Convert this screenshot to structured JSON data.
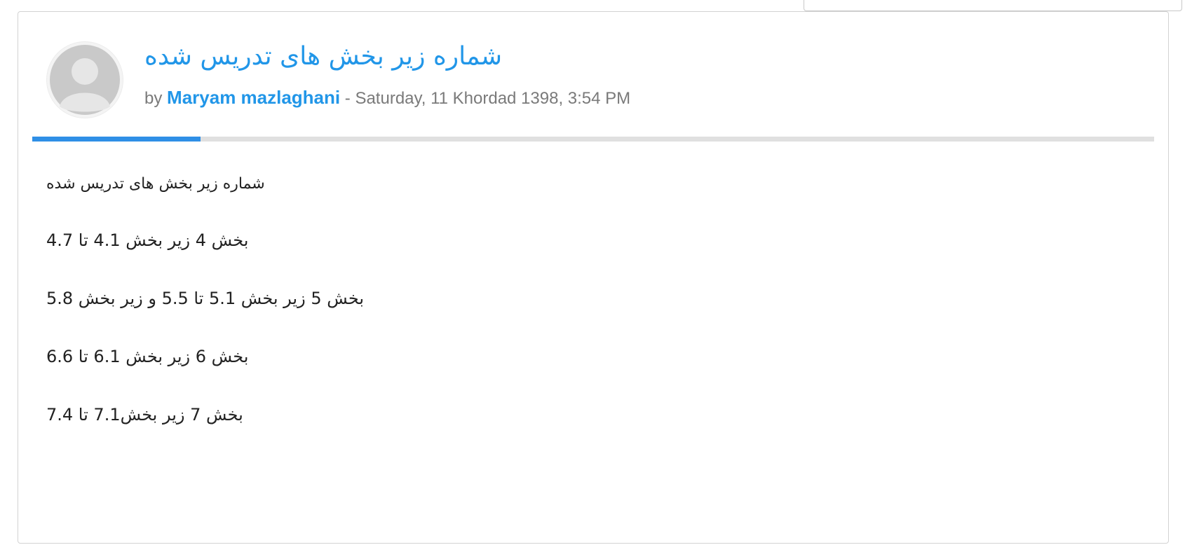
{
  "post": {
    "title": "شماره زیر بخش های تدریس شده",
    "by_prefix": "by",
    "author": "Maryam mazlaghani",
    "date_text": " - Saturday, 11 Khordad 1398, 3:54 PM",
    "read_progress": 0.15,
    "body": [
      "شماره زیر بخش های تدریس شده",
      "بخش 4 زیر بخش 4.1 تا 4.7",
      "بخش 5 زیر بخش 5.1 تا 5.5 و زیر بخش 5.8",
      "بخش 6 زیر بخش 6.1 تا 6.6",
      "بخش 7 زیر بخش7.1 تا 7.4"
    ]
  },
  "colors": {
    "accent": "#2196e8",
    "progress": "#2f8fe6",
    "muted_text": "#7a7a7a"
  },
  "icons": {
    "avatar": "default-user-avatar-icon"
  }
}
